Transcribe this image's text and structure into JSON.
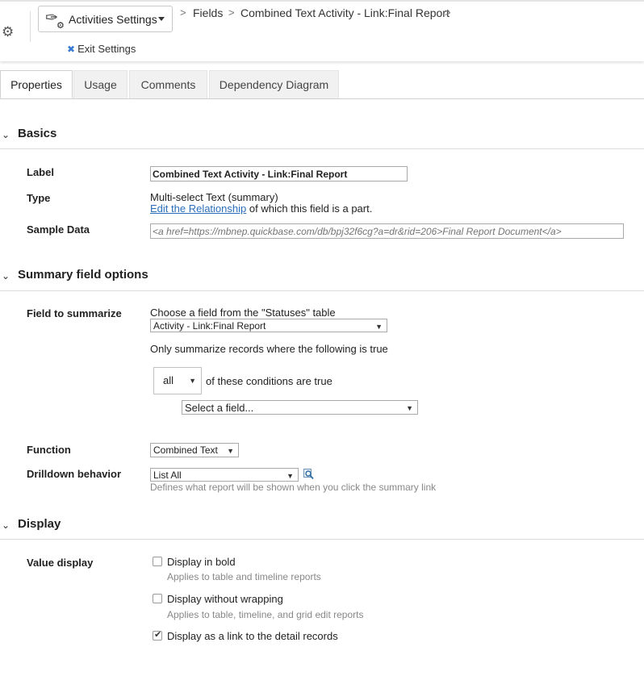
{
  "header": {
    "menu_label": "Activities Settings",
    "exit_label": "Exit Settings",
    "breadcrumb": [
      "Fields",
      "Combined Text Activity - Link:Final Report"
    ],
    "crumb_separator": ">"
  },
  "tabs": [
    {
      "label": "Properties",
      "active": true
    },
    {
      "label": "Usage",
      "active": false
    },
    {
      "label": "Comments",
      "active": false
    },
    {
      "label": "Dependency Diagram",
      "active": false
    }
  ],
  "basics": {
    "title": "Basics",
    "label_label": "Label",
    "label_value": "Combined Text Activity - Link:Final Report",
    "type_label": "Type",
    "type_value": "Multi-select Text (summary)",
    "edit_link": "Edit the Relationship",
    "edit_suffix": "of which this field is a part.",
    "sample_label": "Sample Data",
    "sample_placeholder": "<a href=https://mbnep.quickbase.com/db/bpj32f6cg?a=dr&rid=206>Final Report Document</a>"
  },
  "summary": {
    "title": "Summary field options",
    "field_label": "Field to summarize",
    "choose_text": "Choose a field from the \"Statuses\" table",
    "field_select": "Activity - Link:Final Report",
    "only_text": "Only summarize records where the following is true",
    "all_select": "all",
    "conditions_text": "of these conditions are true",
    "select_field": "Select a field...",
    "function_label": "Function",
    "function_select": "Combined Text",
    "drilldown_label": "Drilldown behavior",
    "drilldown_select": "List All",
    "drilldown_help": "Defines what report will be shown when you click the summary link"
  },
  "display": {
    "title": "Display",
    "value_label": "Value display",
    "options": [
      {
        "label": "Display in bold",
        "help": "Applies to table and timeline reports",
        "checked": false
      },
      {
        "label": "Display without wrapping",
        "help": "Applies to table, timeline, and grid edit reports",
        "checked": false
      },
      {
        "label": "Display as a link to the detail records",
        "help": "",
        "checked": true
      }
    ]
  },
  "icons": {
    "gear": "gear-icon",
    "settings": "feather-gear-icon",
    "exit": "close-icon",
    "drill_search": "magnifier-icon",
    "chevron": "chevron-down-icon"
  },
  "colors": {
    "link": "#2a6ebb",
    "exit_x": "#3a7bd5"
  }
}
